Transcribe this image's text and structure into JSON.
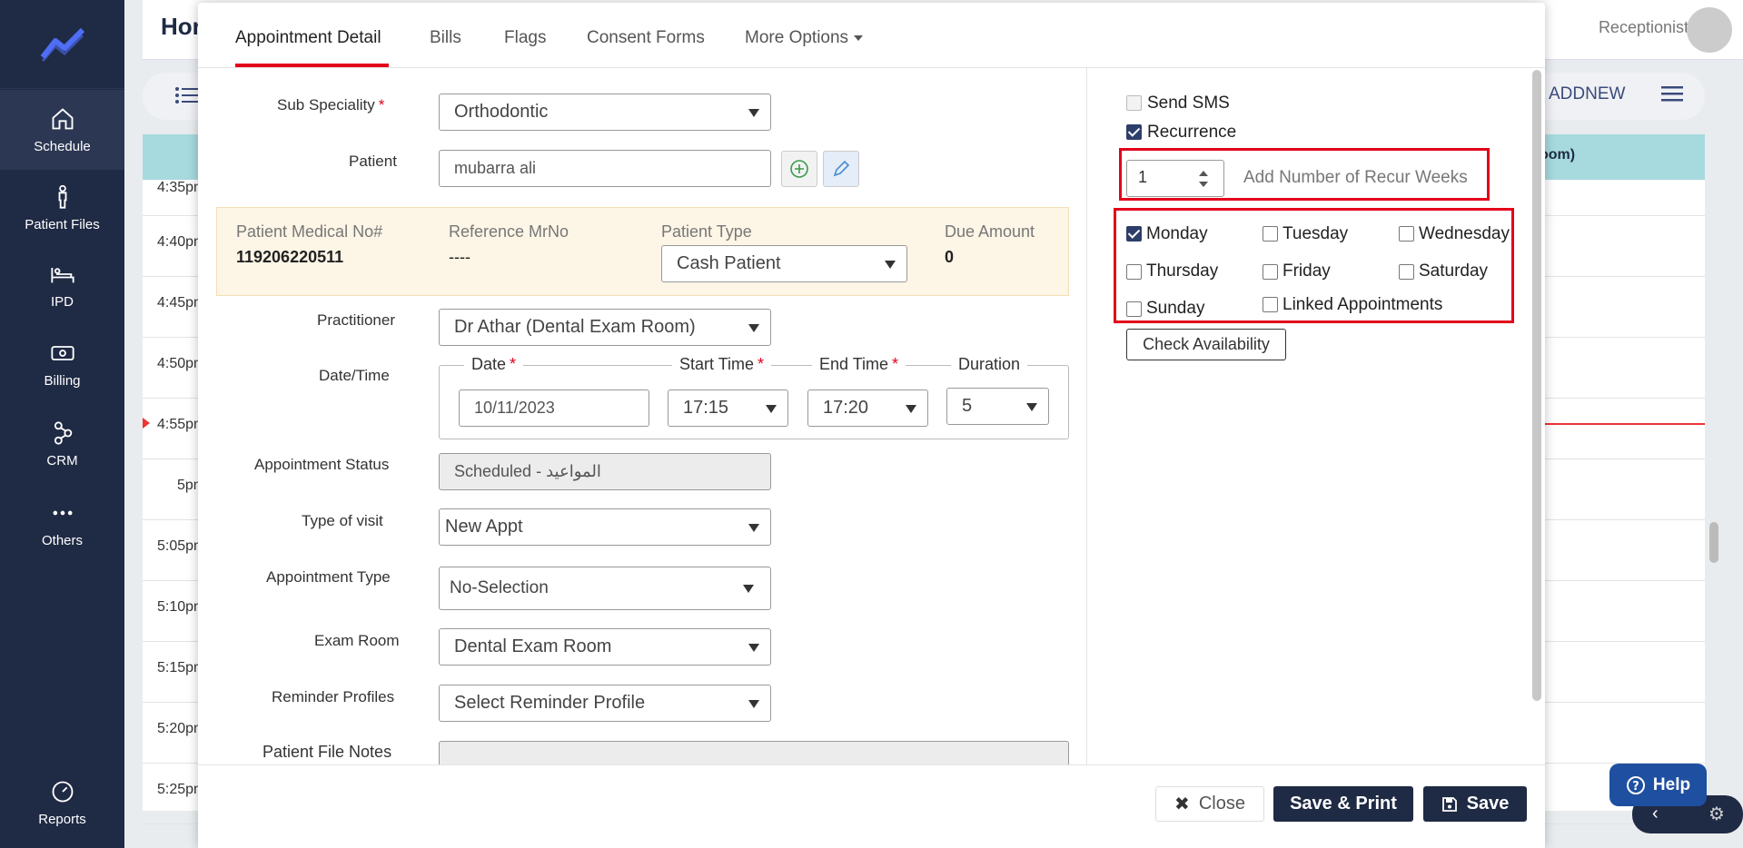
{
  "sidebar": {
    "items": [
      {
        "label": "Schedule",
        "icon": "home-icon"
      },
      {
        "label": "Patient Files",
        "icon": "person-icon"
      },
      {
        "label": "IPD",
        "icon": "bed-icon"
      },
      {
        "label": "Billing",
        "icon": "money-icon"
      },
      {
        "label": "CRM",
        "icon": "network-icon"
      },
      {
        "label": "Others",
        "icon": "more-dots-icon"
      },
      {
        "label": "Reports",
        "icon": "gauge-icon"
      }
    ]
  },
  "background": {
    "title": "Hor",
    "user_role": "Receptionist",
    "addnew": "ADDNEW",
    "room_header": "oom)",
    "times": [
      "4:35pm",
      "4:40pm",
      "4:45pm",
      "4:50pm",
      "4:55pm",
      "5pm",
      "5:05pm",
      "5:10pm",
      "5:15pm",
      "5:20pm",
      "5:25pm"
    ]
  },
  "modal": {
    "tabs": [
      "Appointment Detail",
      "Bills",
      "Flags",
      "Consent Forms",
      "More Options"
    ],
    "form": {
      "sub_speciality_label": "Sub Speciality",
      "sub_speciality_value": "Orthodontic",
      "patient_label": "Patient",
      "patient_value": "mubarra ali",
      "mr_label": "Patient Medical No#",
      "mr_value": "119206220511",
      "ref_label": "Reference MrNo",
      "ref_value": "----",
      "ptype_label": "Patient Type",
      "ptype_value": "Cash Patient",
      "due_label": "Due Amount",
      "due_value": "0",
      "practitioner_label": "Practitioner",
      "practitioner_value": "Dr Athar (Dental Exam Room)",
      "datetime_label": "Date/Time",
      "date_label": "Date",
      "date_value": "10/11/2023",
      "start_label": "Start Time",
      "start_value": "17:15",
      "end_label": "End Time",
      "end_value": "17:20",
      "duration_label": "Duration",
      "duration_value": "5",
      "status_label": "Appointment Status",
      "status_value": "Scheduled - المواعيد",
      "visit_label": "Type of visit",
      "visit_value": "New Appt",
      "appt_type_label": "Appointment Type",
      "appt_type_value": "No-Selection",
      "exam_label": "Exam Room",
      "exam_value": "Dental Exam Room",
      "reminder_label": "Reminder Profiles",
      "reminder_value": "Select Reminder Profile",
      "notes_label": "Patient File Notes"
    },
    "right": {
      "send_sms": "Send SMS",
      "recurrence": "Recurrence",
      "weeks_value": "1",
      "weeks_hint": "Add Number of Recur Weeks",
      "days": [
        {
          "label": "Monday",
          "checked": true
        },
        {
          "label": "Tuesday",
          "checked": false
        },
        {
          "label": "Wednesday",
          "checked": false
        },
        {
          "label": "Thursday",
          "checked": false
        },
        {
          "label": "Friday",
          "checked": false
        },
        {
          "label": "Saturday",
          "checked": false
        },
        {
          "label": "Sunday",
          "checked": false
        },
        {
          "label": "Linked Appointments",
          "checked": false
        }
      ],
      "check_availability": "Check Availability"
    },
    "footer": {
      "close": "Close",
      "save_print": "Save & Print",
      "save": "Save"
    }
  },
  "help": "Help",
  "colors": {
    "sidebar": "#1f2a44",
    "accent_red": "#e3001b",
    "teal_header": "#a6dade",
    "info_band": "#fdf5e6"
  }
}
